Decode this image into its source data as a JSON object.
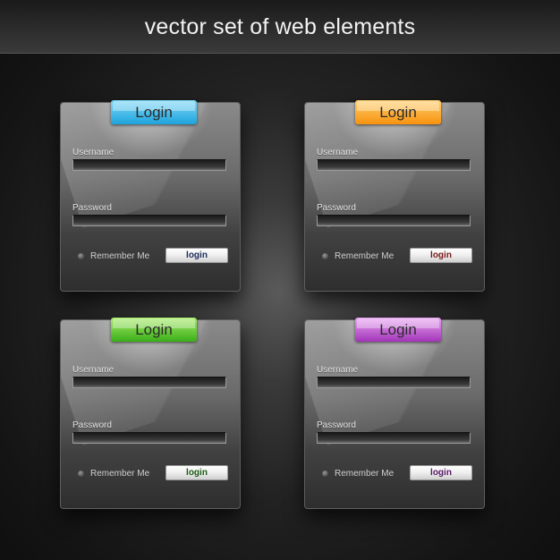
{
  "header": {
    "title": "vector set of web elements"
  },
  "panels": [
    {
      "id": "blue",
      "tab_label": "Login",
      "tab_color_top": "#7ed8f8",
      "tab_color_bottom": "#1ea3dc",
      "username_label": "Username",
      "password_label": "Password",
      "remember_label": "Remember Me",
      "button_label": "login",
      "button_text_color": "#1a2a5a"
    },
    {
      "id": "orange",
      "tab_label": "Login",
      "tab_color_top": "#ffd070",
      "tab_color_bottom": "#f7920e",
      "username_label": "Username",
      "password_label": "Password",
      "remember_label": "Remember Me",
      "button_label": "login",
      "button_text_color": "#7a1a1a"
    },
    {
      "id": "green",
      "tab_label": "Login",
      "tab_color_top": "#a8ec6a",
      "tab_color_bottom": "#3aae18",
      "username_label": "Username",
      "password_label": "Password",
      "remember_label": "Remember Me",
      "button_label": "login",
      "button_text_color": "#1a5a12"
    },
    {
      "id": "purple",
      "tab_label": "Login",
      "tab_color_top": "#e9a4f2",
      "tab_color_bottom": "#a235b8",
      "username_label": "Username",
      "password_label": "Password",
      "remember_label": "Remember Me",
      "button_label": "login",
      "button_text_color": "#5a1a6a"
    }
  ]
}
